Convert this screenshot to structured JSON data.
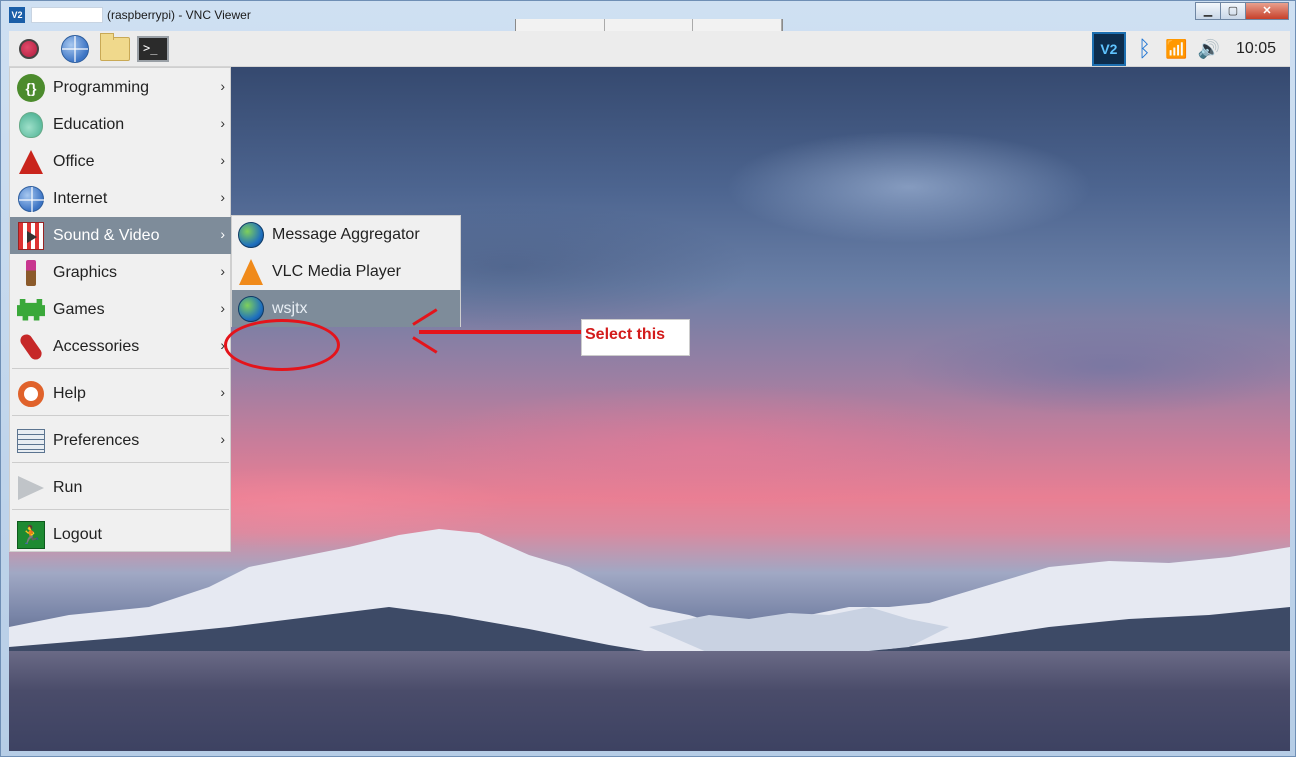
{
  "window": {
    "title": "(raspberrypi) - VNC Viewer",
    "controls": {
      "minimize": "▁",
      "maximize": "▢",
      "close": "✕"
    }
  },
  "taskbar": {
    "clock": "10:05",
    "vnc_icon_text": "V2"
  },
  "menu": {
    "items": [
      {
        "label": "Programming",
        "icon": "programming-icon"
      },
      {
        "label": "Education",
        "icon": "education-icon"
      },
      {
        "label": "Office",
        "icon": "office-icon"
      },
      {
        "label": "Internet",
        "icon": "internet-icon"
      },
      {
        "label": "Sound & Video",
        "icon": "sound-video-icon",
        "selected": true
      },
      {
        "label": "Graphics",
        "icon": "graphics-icon"
      },
      {
        "label": "Games",
        "icon": "games-icon"
      },
      {
        "label": "Accessories",
        "icon": "accessories-icon"
      },
      {
        "label": "Help",
        "icon": "help-icon"
      },
      {
        "label": "Preferences",
        "icon": "preferences-icon"
      },
      {
        "label": "Run",
        "icon": "run-icon"
      },
      {
        "label": "Logout",
        "icon": "logout-icon"
      }
    ],
    "arrow": "›"
  },
  "submenu": {
    "items": [
      {
        "label": "Message Aggregator",
        "icon": "globe-icon"
      },
      {
        "label": "VLC Media Player",
        "icon": "vlc-icon"
      },
      {
        "label": "wsjtx",
        "icon": "globe-icon",
        "highlighted": true
      }
    ]
  },
  "annotation": {
    "callout": "Select this",
    "color": "#e4141b"
  },
  "colors": {
    "selection": "#7e8c9a",
    "accent": "#2276d3"
  }
}
